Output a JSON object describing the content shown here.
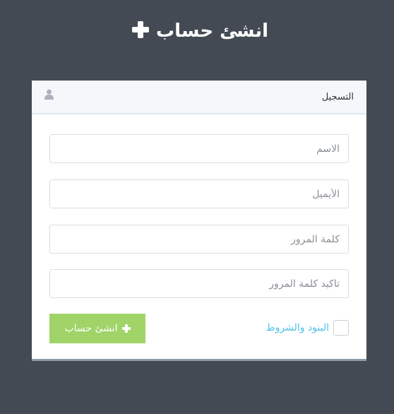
{
  "heading": {
    "title": "انشئ حساب",
    "icon": "plus-icon"
  },
  "panel": {
    "title": "التسجيل",
    "icon": "user-icon"
  },
  "form": {
    "name_placeholder": "الاسم",
    "email_placeholder": "الأيميل",
    "password_placeholder": "كلمة المرور",
    "confirm_password_placeholder": "تاكيد كلمة المرور",
    "terms_label": "البنود والشروط",
    "submit_label": "انشئ حساب"
  },
  "colors": {
    "background": "#434a54",
    "submit": "#a0d468",
    "link": "#4fc1e9"
  }
}
